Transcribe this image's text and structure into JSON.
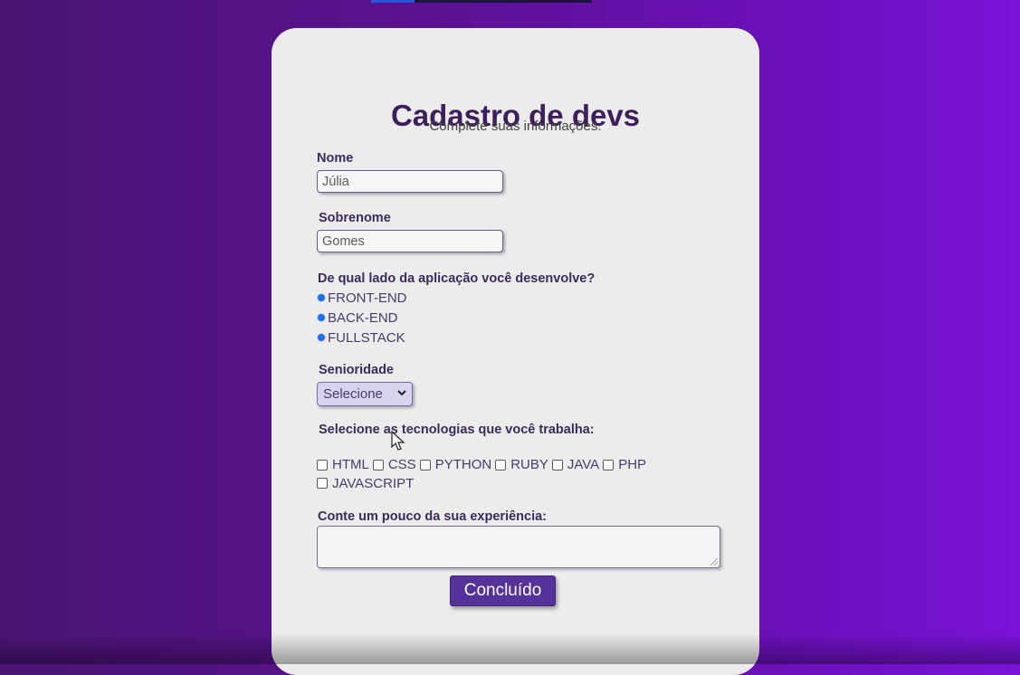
{
  "form": {
    "title": "Cadastro de devs",
    "subtitle": "Complete suas informações.",
    "nome_label": "Nome",
    "nome_value": "Júlia",
    "sobrenome_label": "Sobrenome",
    "sobrenome_value": "Gomes",
    "side_question": "De qual lado da aplicação você desenvolve?",
    "side_options": [
      "FRONT-END",
      "BACK-END",
      "FULLSTACK"
    ],
    "seniority_label": "Senioridade",
    "seniority_value": "Selecione",
    "tech_question": "Selecione as tecnologias que você trabalha:",
    "tech_options": [
      "HTML",
      "CSS",
      "PYTHON",
      "RUBY",
      "JAVA",
      "PHP",
      "JAVASCRIPT"
    ],
    "experience_label": "Conte um pouco da sua experiência:",
    "submit_label": "Concluído"
  },
  "colors": {
    "accent": "#55329a",
    "title": "#3d1f59",
    "radio": "#1e6fe8",
    "background_left": "#4a1474",
    "background_right": "#7a12d8"
  },
  "icons": {
    "select_arrow": "chevron-down-icon",
    "cursor": "mouse-pointer-icon"
  }
}
